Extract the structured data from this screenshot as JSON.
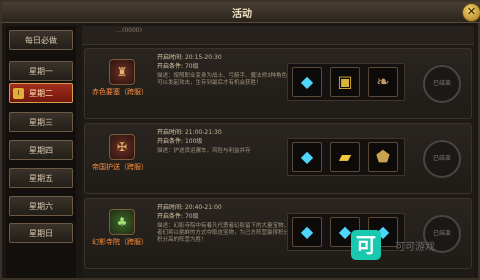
{
  "window": {
    "title": "活动",
    "close_icon": "close-x-icon"
  },
  "sidebar": {
    "items": [
      {
        "label": "每日必做",
        "active": false
      },
      {
        "label": "星期一",
        "active": false
      },
      {
        "label": "星期二",
        "active": true,
        "badge": "Ⅰ"
      },
      {
        "label": "星期三",
        "active": false
      },
      {
        "label": "星期四",
        "active": false
      },
      {
        "label": "星期五",
        "active": false
      },
      {
        "label": "星期六",
        "active": false
      },
      {
        "label": "星期日",
        "active": false
      }
    ]
  },
  "stub": {
    "text": "…(0000)"
  },
  "activities": [
    {
      "name": "赤色要塞（跨服）",
      "icon": "fortress-emblem-icon",
      "time_label": "开启时间:",
      "time": "20:15-20:30",
      "cond_label": "开启条件:",
      "cond": "70级",
      "desc": "描述：按照职业变身为战士、弓箭手、魔法师3种角色，可以发起攻击，生存到最后才有机会获胜！",
      "rewards": [
        "diamond-icon",
        "gift-box-icon",
        "scroll-icon"
      ],
      "status": "已结束"
    },
    {
      "name": "帝国护送（跨服）",
      "icon": "escort-emblem-icon",
      "time_label": "开启时间:",
      "time": "21:00-21:30",
      "cond_label": "开启条件:",
      "cond": "100级",
      "desc": "描述：护送货运骡车，风险与利益并存",
      "rewards": [
        "diamond-icon",
        "gold-ingot-icon",
        "armor-badge-icon"
      ],
      "status": "已结束"
    },
    {
      "name": "幻影寺院（跨服）",
      "icon": "temple-emblem-icon",
      "time_label": "开启时间:",
      "time": "20:40-21:00",
      "cond_label": "开启条件:",
      "cond": "70级",
      "desc": "描述：幻影寺院中有着凡代勇者幻影留下的大量宝物，勇者们将以挑衅的方式夺取这宝物，为己方阵营赢得积分，积分高的阵营为胜！",
      "rewards": [
        "diamond-icon",
        "diamond-icon",
        "diamond-icon"
      ],
      "status": "已结束"
    }
  ],
  "watermark": {
    "logo": "可",
    "text": "可可游戏"
  }
}
